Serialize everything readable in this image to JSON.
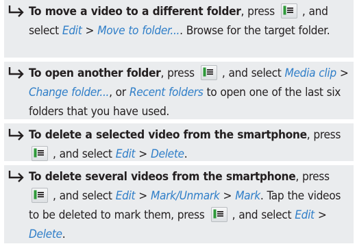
{
  "items": [
    {
      "lead": "To move a video to a different folder",
      "segments": [
        ", press ",
        "[key]",
        " , and select ",
        "{Edit}",
        " > ",
        "{Move to folder...}",
        ". Browse for the target folder."
      ]
    },
    {
      "lead": "To open another folder",
      "segments": [
        ", press ",
        "[key]",
        " , and select ",
        "{Media clip}",
        " > ",
        "{Change folder...}",
        ", or ",
        "{Recent folders}",
        " to open one of the last six folders that you have used."
      ]
    },
    {
      "lead": "To delete a selected video from the smartphone",
      "segments": [
        ", press ",
        "[key]",
        " , and select ",
        "{Edit}",
        " > ",
        "{Delete}",
        "."
      ]
    },
    {
      "lead": "To delete several videos from the smartphone",
      "segments": [
        ", press ",
        "[key]",
        " , and select ",
        "{Edit}",
        " > ",
        "{Mark/Unmark}",
        " > ",
        "{Mark}",
        ". Tap the videos to be deleted to mark them, press ",
        "[key]",
        " , and select ",
        "{Edit}",
        " > ",
        "{Delete}",
        "."
      ]
    }
  ],
  "icons": {
    "bullet": "hook-arrow-right-icon",
    "menu_key": "menu-key-icon"
  },
  "colors": {
    "link": "#2f7ec8",
    "panel": "#eaecee",
    "text": "#231f20"
  }
}
